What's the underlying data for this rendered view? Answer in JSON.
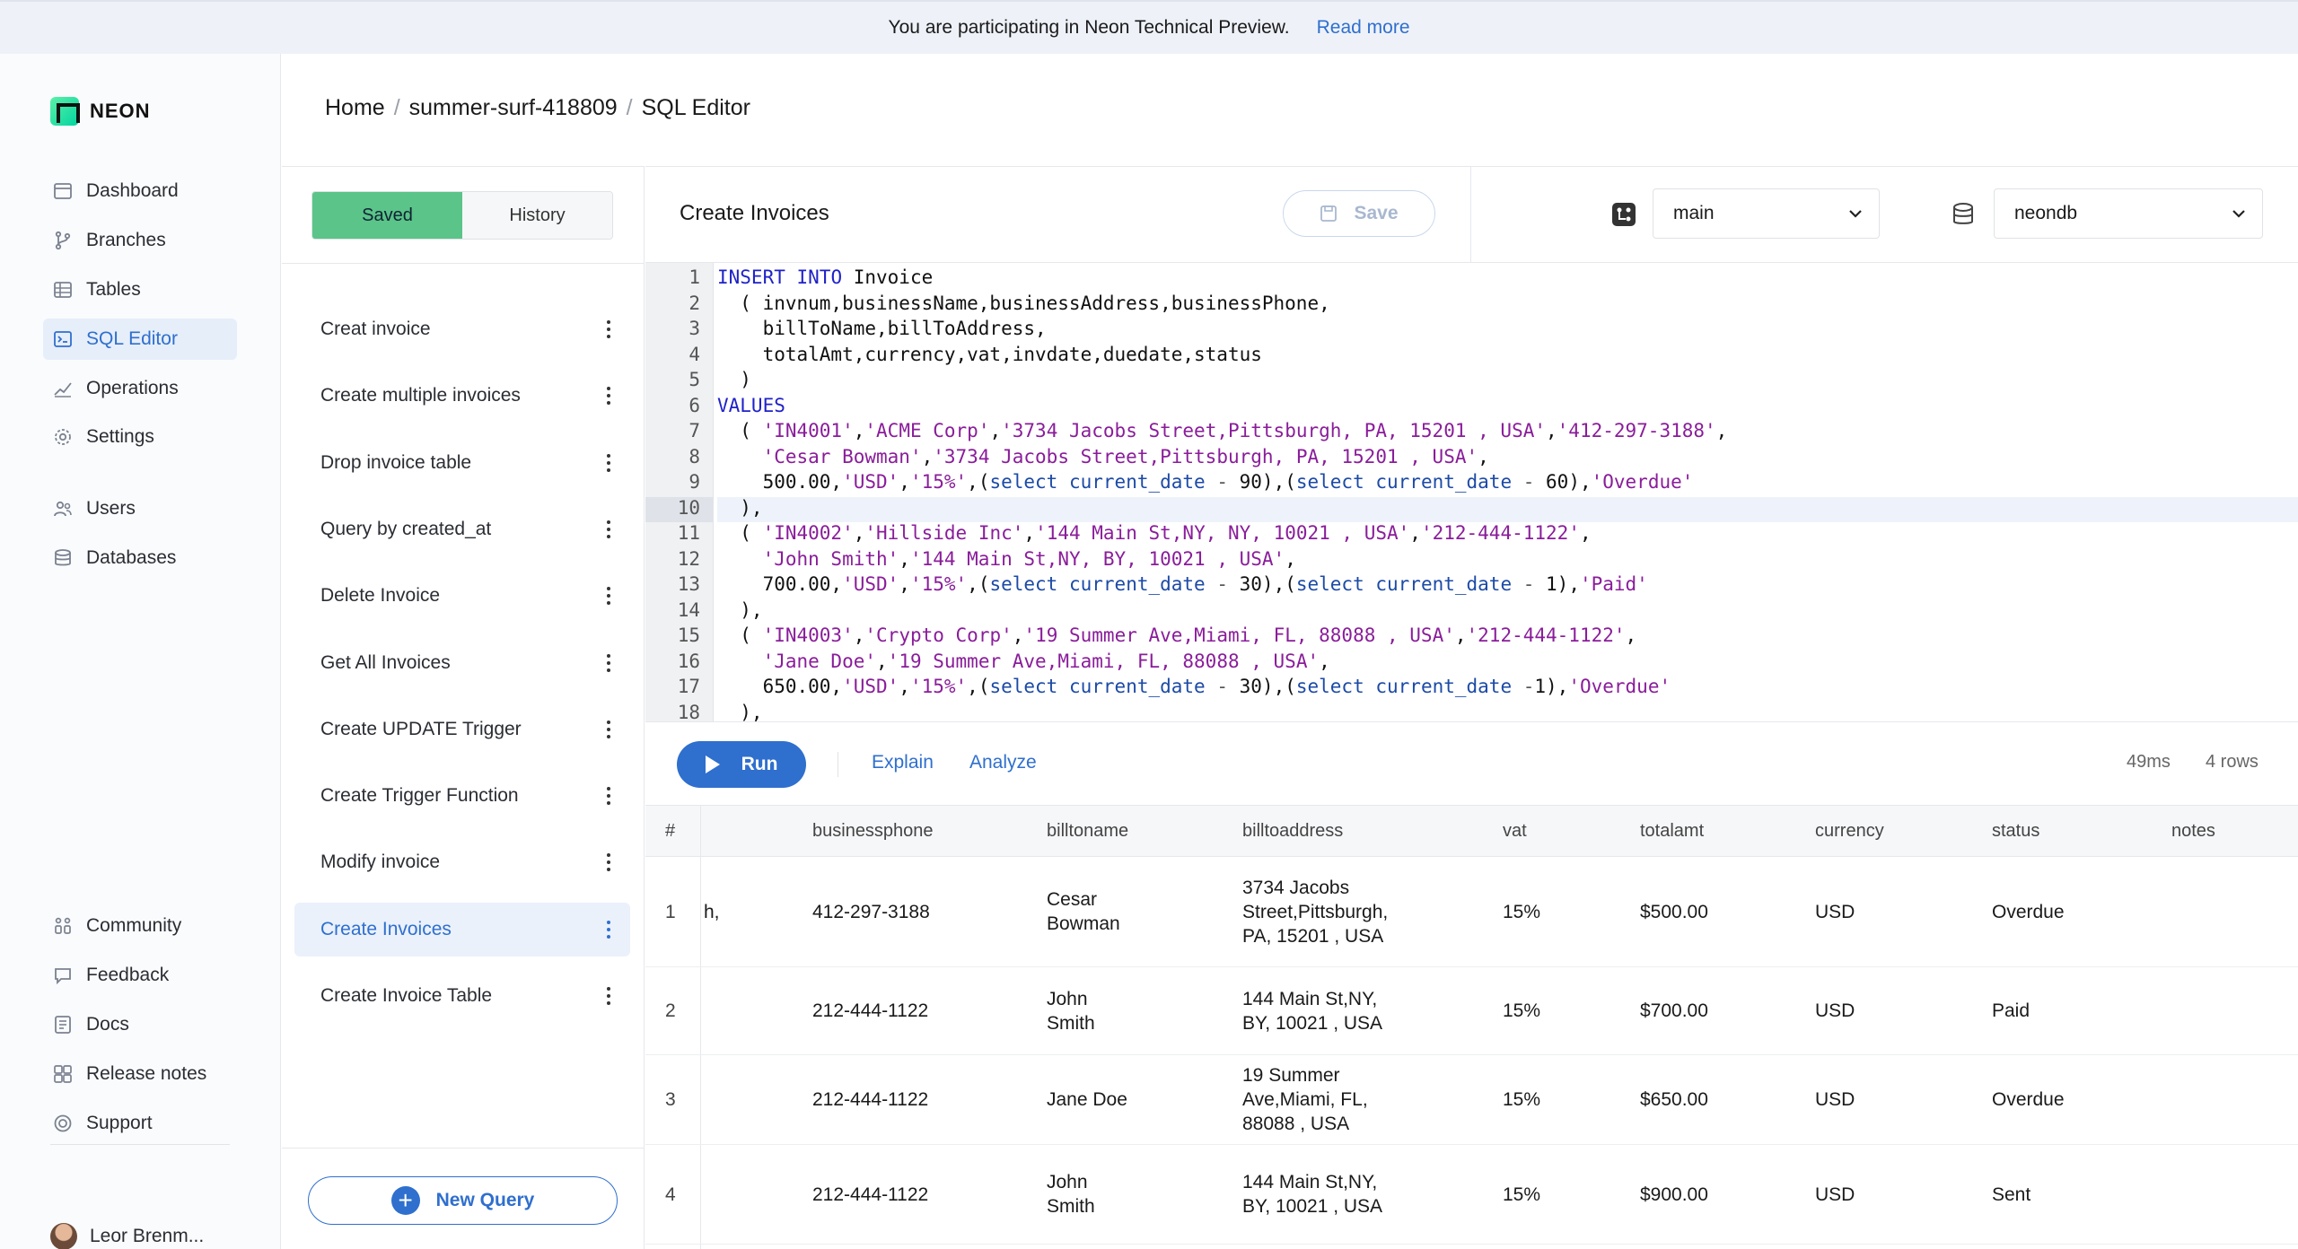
{
  "banner": {
    "text": "You are participating in Neon Technical Preview.",
    "link": "Read more"
  },
  "brand": {
    "name": "NEON",
    "accent": "#2f6fce",
    "green": "#5ac489"
  },
  "sidebar": {
    "items": [
      {
        "label": "Dashboard",
        "icon": "dashboard-icon"
      },
      {
        "label": "Branches",
        "icon": "branch-icon"
      },
      {
        "label": "Tables",
        "icon": "table-icon"
      },
      {
        "label": "SQL Editor",
        "icon": "sql-editor-icon",
        "active": true
      },
      {
        "label": "Operations",
        "icon": "operations-icon"
      },
      {
        "label": "Settings",
        "icon": "gear-icon"
      },
      {
        "label": "Users",
        "icon": "users-icon"
      },
      {
        "label": "Databases",
        "icon": "database-icon"
      }
    ],
    "footer": [
      {
        "label": "Community",
        "icon": "community-icon"
      },
      {
        "label": "Feedback",
        "icon": "feedback-icon"
      },
      {
        "label": "Docs",
        "icon": "docs-icon"
      },
      {
        "label": "Release notes",
        "icon": "release-notes-icon"
      },
      {
        "label": "Support",
        "icon": "support-icon"
      }
    ],
    "user": "Leor Brenm..."
  },
  "breadcrumb": [
    "Home",
    "summer-surf-418809",
    "SQL Editor"
  ],
  "queries": {
    "tabs": {
      "saved": "Saved",
      "history": "History"
    },
    "items": [
      "Creat invoice",
      "Create multiple invoices",
      "Drop invoice table",
      "Query by created_at",
      "Delete Invoice",
      "Get All Invoices",
      "Create UPDATE Trigger",
      "Create Trigger Function",
      "Modify invoice",
      "Create Invoices",
      "Create Invoice Table"
    ],
    "active_index": 9,
    "new_query": "New Query"
  },
  "editor": {
    "title": "Create Invoices",
    "save": "Save",
    "branch": "main",
    "database": "neondb",
    "current_line": 10,
    "lines": [
      "INSERT INTO Invoice",
      "  ( invnum,businessName,businessAddress,businessPhone,",
      "    billToName,billToAddress,",
      "    totalAmt,currency,vat,invdate,duedate,status",
      "  )",
      "VALUES",
      "  ( 'IN4001','ACME Corp','3734 Jacobs Street,Pittsburgh, PA, 15201 , USA','412-297-3188',",
      "    'Cesar Bowman','3734 Jacobs Street,Pittsburgh, PA, 15201 , USA',",
      "    500.00,'USD','15%',(select current_date - 90),(select current_date - 60),'Overdue'",
      "  ),",
      "  ( 'IN4002','Hillside Inc','144 Main St,NY, NY, 10021 , USA','212-444-1122',",
      "    'John Smith','144 Main St,NY, BY, 10021 , USA',",
      "    700.00,'USD','15%',(select current_date - 30),(select current_date - 1),'Paid'",
      "  ),",
      "  ( 'IN4003','Crypto Corp','19 Summer Ave,Miami, FL, 88088 , USA','212-444-1122',",
      "    'Jane Doe','19 Summer Ave,Miami, FL, 88088 , USA',",
      "    650.00,'USD','15%',(select current_date - 30),(select current_date -1),'Overdue'",
      "  ),"
    ]
  },
  "runbar": {
    "run": "Run",
    "explain": "Explain",
    "analyze": "Analyze",
    "time": "49ms",
    "rows": "4 rows"
  },
  "results": {
    "columns": [
      "#",
      "businessphone",
      "billtoname",
      "billtoaddress",
      "vat",
      "totalamt",
      "currency",
      "status",
      "notes"
    ],
    "clipped_prefix": [
      "h,",
      "",
      "",
      ""
    ],
    "rows": [
      {
        "n": "1",
        "phone": "412-297-3188",
        "name": [
          "Cesar",
          "Bowman"
        ],
        "addr": [
          "3734 Jacobs",
          "Street,Pittsburgh,",
          "PA, 15201 , USA"
        ],
        "vat": "15%",
        "total": "$500.00",
        "currency": "USD",
        "status": "Overdue"
      },
      {
        "n": "2",
        "phone": "212-444-1122",
        "name": [
          "John",
          "Smith"
        ],
        "addr": [
          "144 Main St,NY,",
          "BY, 10021 , USA"
        ],
        "vat": "15%",
        "total": "$700.00",
        "currency": "USD",
        "status": "Paid"
      },
      {
        "n": "3",
        "phone": "212-444-1122",
        "name": [
          "Jane Doe"
        ],
        "addr": [
          "19 Summer",
          "Ave,Miami, FL,",
          "88088 , USA"
        ],
        "vat": "15%",
        "total": "$650.00",
        "currency": "USD",
        "status": "Overdue"
      },
      {
        "n": "4",
        "phone": "212-444-1122",
        "name": [
          "John",
          "Smith"
        ],
        "addr": [
          "144 Main St,NY,",
          "BY, 10021 , USA"
        ],
        "vat": "15%",
        "total": "$900.00",
        "currency": "USD",
        "status": "Sent"
      }
    ]
  }
}
